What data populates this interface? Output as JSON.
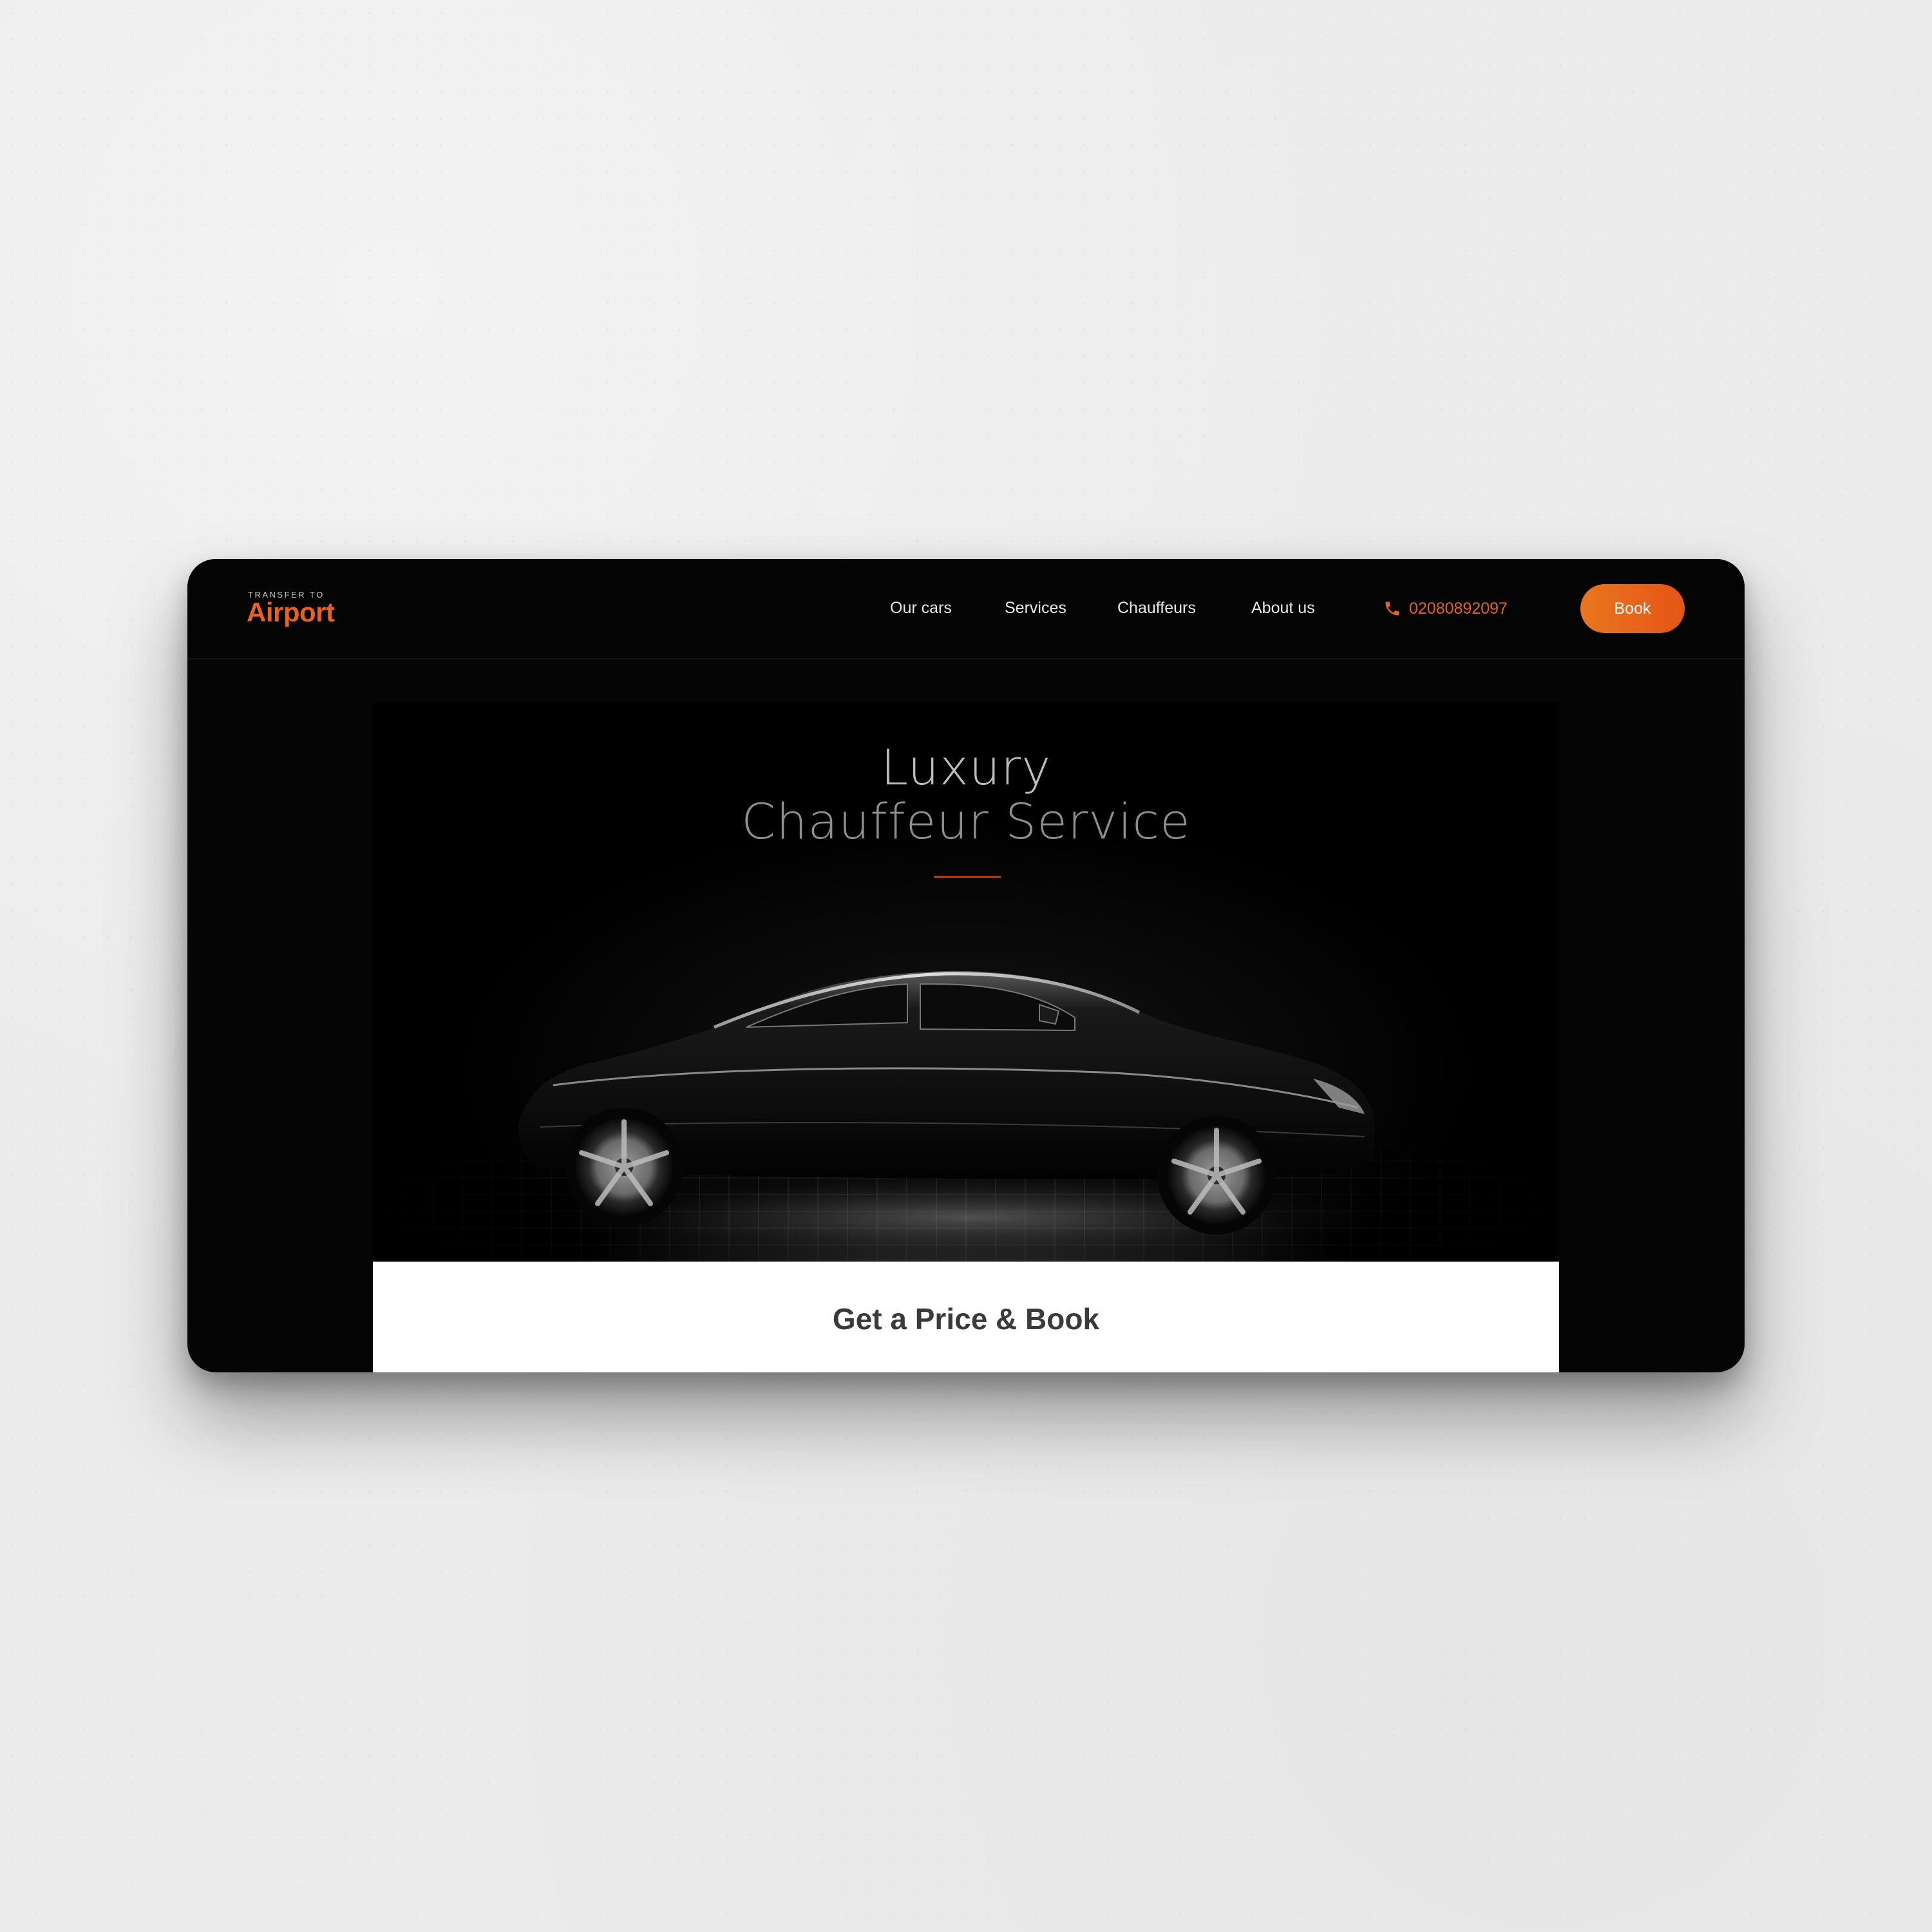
{
  "brand": {
    "tagline": "TRANSFER TO",
    "name": "Airport"
  },
  "nav": {
    "links": [
      {
        "label": "Our cars"
      },
      {
        "label": "Services"
      },
      {
        "label": "Chauffeurs"
      },
      {
        "label": "About us"
      }
    ],
    "phone": "02080892097",
    "book_label": "Book"
  },
  "hero": {
    "title_line1": "Luxury",
    "title_line2": "Chauffeur Service"
  },
  "booking": {
    "title": "Get a Price & Book"
  },
  "colors": {
    "accent": "#e8611f",
    "background": "#050505",
    "panel": "#ffffff"
  },
  "icons": {
    "phone": "phone-icon"
  }
}
